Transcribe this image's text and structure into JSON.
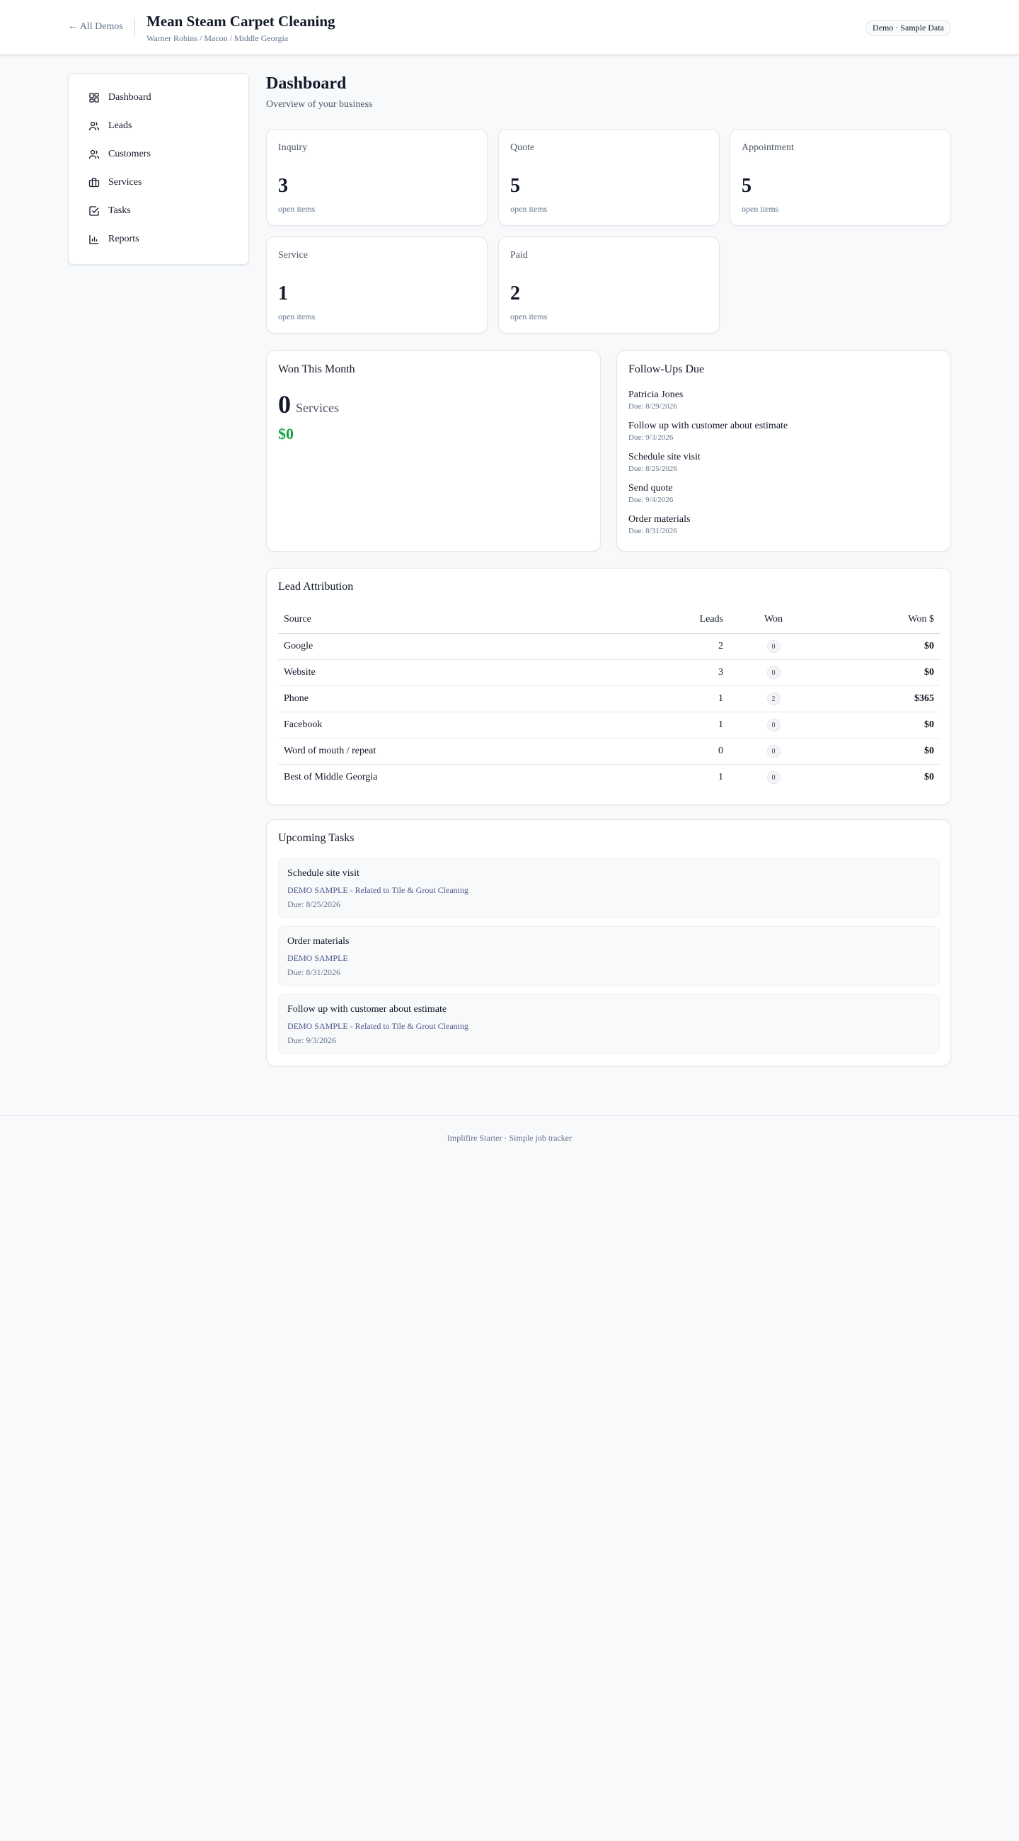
{
  "header": {
    "back_label": "← All Demos",
    "title": "Mean Steam Carpet Cleaning",
    "subtitle": "Warner Robins / Macon / Middle Georgia",
    "badge": "Demo · Sample Data"
  },
  "sidebar": {
    "items": [
      {
        "label": "Dashboard",
        "icon": "dashboard-icon"
      },
      {
        "label": "Leads",
        "icon": "users-icon"
      },
      {
        "label": "Customers",
        "icon": "users-icon"
      },
      {
        "label": "Services",
        "icon": "briefcase-icon"
      },
      {
        "label": "Tasks",
        "icon": "check-square-icon"
      },
      {
        "label": "Reports",
        "icon": "bar-chart-icon"
      }
    ]
  },
  "page": {
    "title": "Dashboard",
    "subtitle": "Overview of your business"
  },
  "stats": [
    {
      "label": "Inquiry",
      "value": "3",
      "foot": "open items"
    },
    {
      "label": "Quote",
      "value": "5",
      "foot": "open items"
    },
    {
      "label": "Appointment",
      "value": "5",
      "foot": "open items"
    },
    {
      "label": "Service",
      "value": "1",
      "foot": "open items"
    },
    {
      "label": "Paid",
      "value": "2",
      "foot": "open items"
    }
  ],
  "won_this_month": {
    "title": "Won This Month",
    "count": "0",
    "unit": "Services",
    "amount": "$0"
  },
  "follow_ups": {
    "title": "Follow-Ups Due",
    "items": [
      {
        "name": "Patricia Jones",
        "due": "Due: 8/29/2026"
      },
      {
        "name": "Follow up with customer about estimate",
        "due": "Due: 9/3/2026"
      },
      {
        "name": "Schedule site visit",
        "due": "Due: 8/25/2026"
      },
      {
        "name": "Send quote",
        "due": "Due: 9/4/2026"
      },
      {
        "name": "Order materials",
        "due": "Due: 8/31/2026"
      }
    ]
  },
  "attribution": {
    "title": "Lead Attribution",
    "headers": {
      "source": "Source",
      "leads": "Leads",
      "won": "Won",
      "won_amount": "Won $"
    },
    "rows": [
      {
        "source": "Google",
        "leads": "2",
        "won": "0",
        "won_amount": "$0"
      },
      {
        "source": "Website",
        "leads": "3",
        "won": "0",
        "won_amount": "$0"
      },
      {
        "source": "Phone",
        "leads": "1",
        "won": "2",
        "won_amount": "$365"
      },
      {
        "source": "Facebook",
        "leads": "1",
        "won": "0",
        "won_amount": "$0"
      },
      {
        "source": "Word of mouth / repeat",
        "leads": "0",
        "won": "0",
        "won_amount": "$0"
      },
      {
        "source": "Best of Middle Georgia",
        "leads": "1",
        "won": "0",
        "won_amount": "$0"
      }
    ]
  },
  "tasks": {
    "title": "Upcoming Tasks",
    "items": [
      {
        "title": "Schedule site visit",
        "related": "DEMO SAMPLE - Related to Tile & Grout Cleaning",
        "due": "Due: 8/25/2026"
      },
      {
        "title": "Order materials",
        "related": "DEMO SAMPLE",
        "due": "Due: 8/31/2026"
      },
      {
        "title": "Follow up with customer about estimate",
        "related": "DEMO SAMPLE - Related to Tile & Grout Cleaning",
        "due": "Due: 9/3/2026"
      }
    ]
  },
  "footer": {
    "text": "Implifire Starter · Simple job tracker"
  }
}
